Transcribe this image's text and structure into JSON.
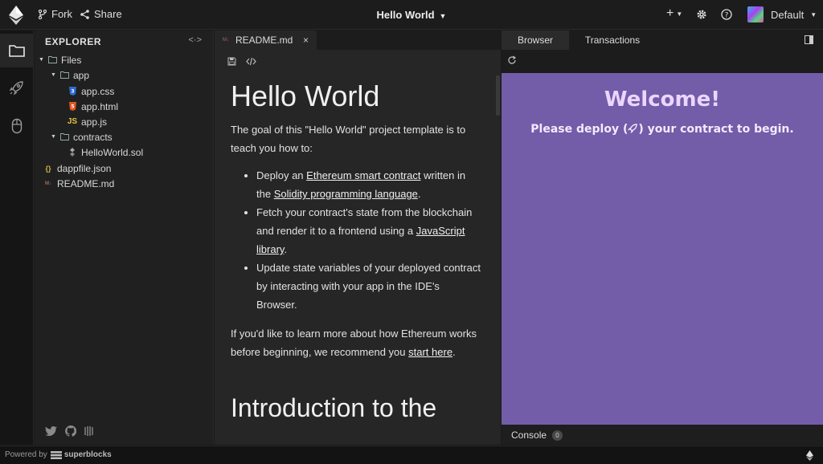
{
  "topbar": {
    "fork_label": "Fork",
    "share_label": "Share",
    "project_title": "Hello World",
    "add_label": "+",
    "environment_label": "Default"
  },
  "rail": {
    "items": [
      {
        "name": "files",
        "icon": "folder-icon"
      },
      {
        "name": "deploy",
        "icon": "rocket-icon"
      },
      {
        "name": "interact",
        "icon": "mouse-icon"
      }
    ]
  },
  "explorer": {
    "title": "EXPLORER",
    "toggle_label": "<·>",
    "tree": [
      {
        "label": "Files",
        "type": "folder",
        "depth": 0,
        "expanded": true
      },
      {
        "label": "app",
        "type": "folder",
        "depth": 1,
        "expanded": true
      },
      {
        "label": "app.css",
        "type": "css",
        "depth": 2
      },
      {
        "label": "app.html",
        "type": "html",
        "depth": 2
      },
      {
        "label": "app.js",
        "type": "js",
        "depth": 2
      },
      {
        "label": "contracts",
        "type": "folder",
        "depth": 1,
        "expanded": true
      },
      {
        "label": "HelloWorld.sol",
        "type": "sol",
        "depth": 2
      },
      {
        "label": "dappfile.json",
        "type": "json",
        "depth": 1
      },
      {
        "label": "README.md",
        "type": "md",
        "depth": 1
      }
    ]
  },
  "editor": {
    "tab_label": "README.md",
    "tab_close": "×",
    "doc": {
      "h1": "Hello World",
      "intro": "The goal of this \"Hello World\" project template is to teach you how to:",
      "bullets": [
        {
          "before": "Deploy an ",
          "link1": "Ethereum smart contract",
          "middle": " written in the ",
          "link2": "Solidity programming language",
          "after": "."
        },
        {
          "before": "Fetch your contract's state from the blockchain and render it to a frontend using a ",
          "link1": "JavaScript library",
          "middle": "",
          "link2": "",
          "after": "."
        },
        {
          "before": "Update state variables of your deployed contract by interacting with your app in the IDE's Browser.",
          "link1": "",
          "middle": "",
          "link2": "",
          "after": ""
        }
      ],
      "outro_before": "If you'd like to learn more about how Ethereum works before beginning, we recommend you ",
      "outro_link": "start here",
      "outro_after": ".",
      "h2": "Introduction to the"
    }
  },
  "rightpanel": {
    "tabs": [
      "Browser",
      "Transactions"
    ],
    "active_tab": "Browser",
    "welcome": "Welcome!",
    "deploy_before": "Please deploy (",
    "deploy_after": ") your contract to begin.",
    "background_color": "#735ca8",
    "console_label": "Console",
    "console_count": "0"
  },
  "statusbar": {
    "powered_by": "Powered by",
    "brand": "superblocks"
  }
}
